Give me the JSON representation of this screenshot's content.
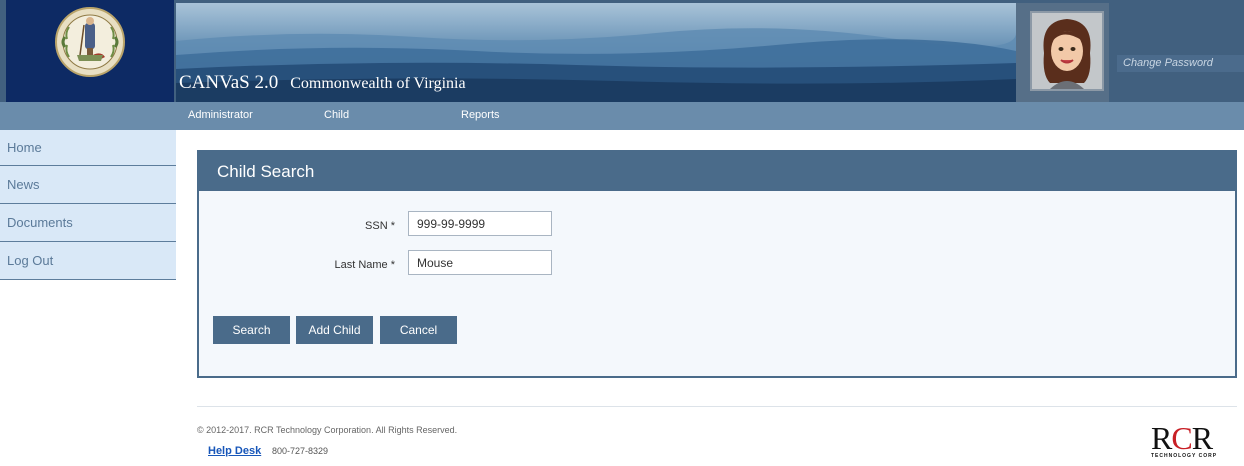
{
  "header": {
    "app_name": "CANVaS 2.0",
    "app_subtitle": "Commonwealth of Virginia",
    "change_password": "Change Password"
  },
  "topnav": {
    "items": [
      {
        "label": "Administrator"
      },
      {
        "label": "Child"
      },
      {
        "label": "Reports"
      }
    ]
  },
  "sidebar": {
    "items": [
      {
        "label": "Home"
      },
      {
        "label": "News"
      },
      {
        "label": "Documents"
      },
      {
        "label": "Log Out"
      }
    ]
  },
  "panel": {
    "title": "Child Search",
    "fields": [
      {
        "label": "SSN *",
        "value": "999-99-9999"
      },
      {
        "label": "Last Name *",
        "value": "Mouse"
      }
    ],
    "buttons": {
      "search": "Search",
      "add_child": "Add Child",
      "cancel": "Cancel"
    }
  },
  "footer": {
    "copyright": "© 2012-2017. RCR Technology Corporation. All Rights Reserved.",
    "help_desk": "Help Desk",
    "phone": "800-727-8329",
    "logo_text": "RCR",
    "logo_tagline": "TECHNOLOGY CORP"
  },
  "colors": {
    "header_bg": "#41607f",
    "seal_bg": "#0d2a64",
    "nav_bg": "#6a8cab",
    "sidebar_bg": "#d9e8f7",
    "panel_head": "#4a6b8a",
    "button_bg": "#4a6b8a",
    "link": "#1756b9",
    "logo_red": "#c81f25"
  },
  "icons": {
    "seal": "virginia-seal-icon",
    "avatar": "user-avatar"
  }
}
